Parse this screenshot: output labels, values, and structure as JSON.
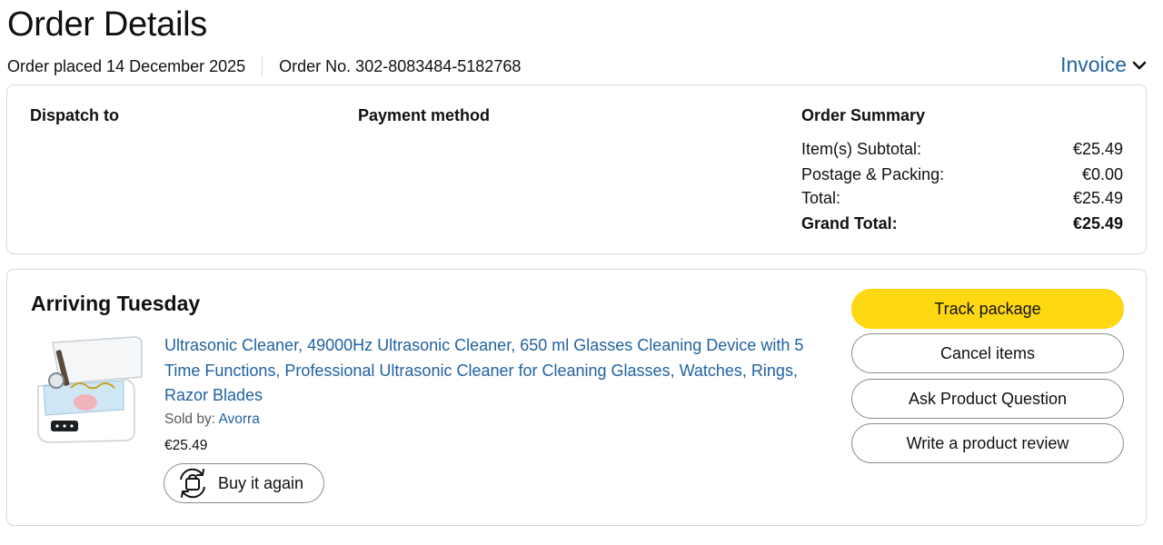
{
  "header": {
    "title": "Order Details",
    "order_placed": "Order placed 14 December 2025",
    "order_number": "Order No. 302-8083484-5182768",
    "invoice_label": "Invoice",
    "invoice_icon": "chevron-down-icon"
  },
  "summary": {
    "dispatch_to_label": "Dispatch to",
    "payment_method_label": "Payment method",
    "order_summary_label": "Order Summary",
    "rows": [
      {
        "label": "Item(s) Subtotal:",
        "value": "€25.49"
      },
      {
        "label": "Postage & Packing:",
        "value": "€0.00"
      },
      {
        "label": "Total:",
        "value": "€25.49"
      },
      {
        "label": "Grand Total:",
        "value": "€25.49"
      }
    ]
  },
  "shipment": {
    "status": "Arriving Tuesday",
    "product": {
      "title": "Ultrasonic Cleaner, 49000Hz Ultrasonic Cleaner, 650 ml Glasses Cleaning Device with 5 Time Functions, Professional Ultrasonic Cleaner for Cleaning Glasses, Watches, Rings, Razor Blades",
      "sold_by_label": "Sold by:",
      "seller": "Avorra",
      "price": "€25.49",
      "buy_again_label": "Buy it again",
      "image": "ultrasonic-cleaner-product-image"
    },
    "actions": {
      "track_package": "Track package",
      "cancel_items": "Cancel items",
      "ask_question": "Ask Product Question",
      "write_review": "Write a product review"
    }
  },
  "colors": {
    "link": "#2162a1",
    "primary_button": "#ffd814",
    "border": "#d5d9d9"
  }
}
